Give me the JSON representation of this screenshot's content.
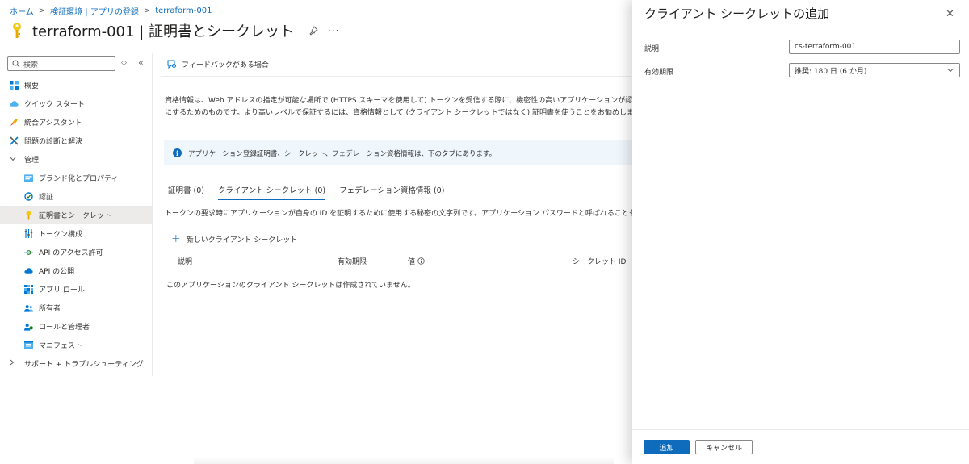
{
  "breadcrumb": {
    "items": [
      "ホーム",
      "検証環境 | アプリの登録",
      "terraform-001"
    ],
    "separator": ">"
  },
  "header": {
    "title": "terraform-001 | 証明書とシークレット",
    "more": "···"
  },
  "sidebar": {
    "search_placeholder": "検索",
    "sort_icon": "◇",
    "collapse_icon": "«",
    "items": [
      {
        "label": "概要",
        "icon": "overview-icon"
      },
      {
        "label": "クイック スタート",
        "icon": "cloud-icon"
      },
      {
        "label": "統合アシスタント",
        "icon": "rocket-icon"
      },
      {
        "label": "問題の診断と解決",
        "icon": "wrench-icon"
      },
      {
        "label": "管理",
        "icon": "chevron-down-icon"
      },
      {
        "label": "ブランド化とプロパティ",
        "icon": "branding-icon"
      },
      {
        "label": "認証",
        "icon": "auth-icon"
      },
      {
        "label": "証明書とシークレット",
        "icon": "key-icon"
      },
      {
        "label": "トークン構成",
        "icon": "token-icon"
      },
      {
        "label": "API のアクセス許可",
        "icon": "api-permission-icon"
      },
      {
        "label": "API の公開",
        "icon": "cloud-api-icon"
      },
      {
        "label": "アプリ ロール",
        "icon": "app-roles-icon"
      },
      {
        "label": "所有者",
        "icon": "owners-icon"
      },
      {
        "label": "ロールと管理者",
        "icon": "roles-admin-icon"
      },
      {
        "label": "マニフェスト",
        "icon": "manifest-icon"
      },
      {
        "label": "サポート + トラブルシューティング",
        "icon": "chevron-right-icon"
      }
    ]
  },
  "main": {
    "feedback": "フィードバックがある場合",
    "description_line1": "資格情報は、Web アドレスの指定が可能な場所で (HTTPS スキーマを使用して) トークンを受信する際に、機密性の高いアプリケーションが認証サー",
    "description_line2": "にするためのものです。より高いレベルで保証するには、資格情報として (クライアント シークレットではなく) 証明書を使うことをお勧めします。",
    "info": "アプリケーション登録証明書、シークレット、フェデレーション資格情報は、下のタブにあります。",
    "tabs": [
      {
        "label": "証明書 (0)"
      },
      {
        "label": "クライアント シークレット (0)"
      },
      {
        "label": "フェデレーション資格情報 (0)"
      }
    ],
    "tab_description": "トークンの要求時にアプリケーションが自身の ID を証明するために使用する秘密の文字列です。アプリケーション パスワードと呼ばれることもあります。",
    "new_secret": "新しいクライアント シークレット",
    "table_headers": [
      "説明",
      "有効期限",
      "値",
      "シークレット ID"
    ],
    "empty_message": "このアプリケーションのクライアント シークレットは作成されていません。"
  },
  "panel": {
    "title": "クライアント シークレットの追加",
    "close": "✕",
    "description_label": "説明",
    "description_value": "cs-terraform-001",
    "expiry_label": "有効期限",
    "expiry_value": "推奨: 180 日 (6 か月)",
    "add_button": "追加",
    "cancel_button": "キャンセル"
  },
  "colors": {
    "accent": "#0f6cbd",
    "info_bg": "#eff6fc",
    "active_nav": "#edebe9",
    "key_yellow": "#f2c811"
  }
}
